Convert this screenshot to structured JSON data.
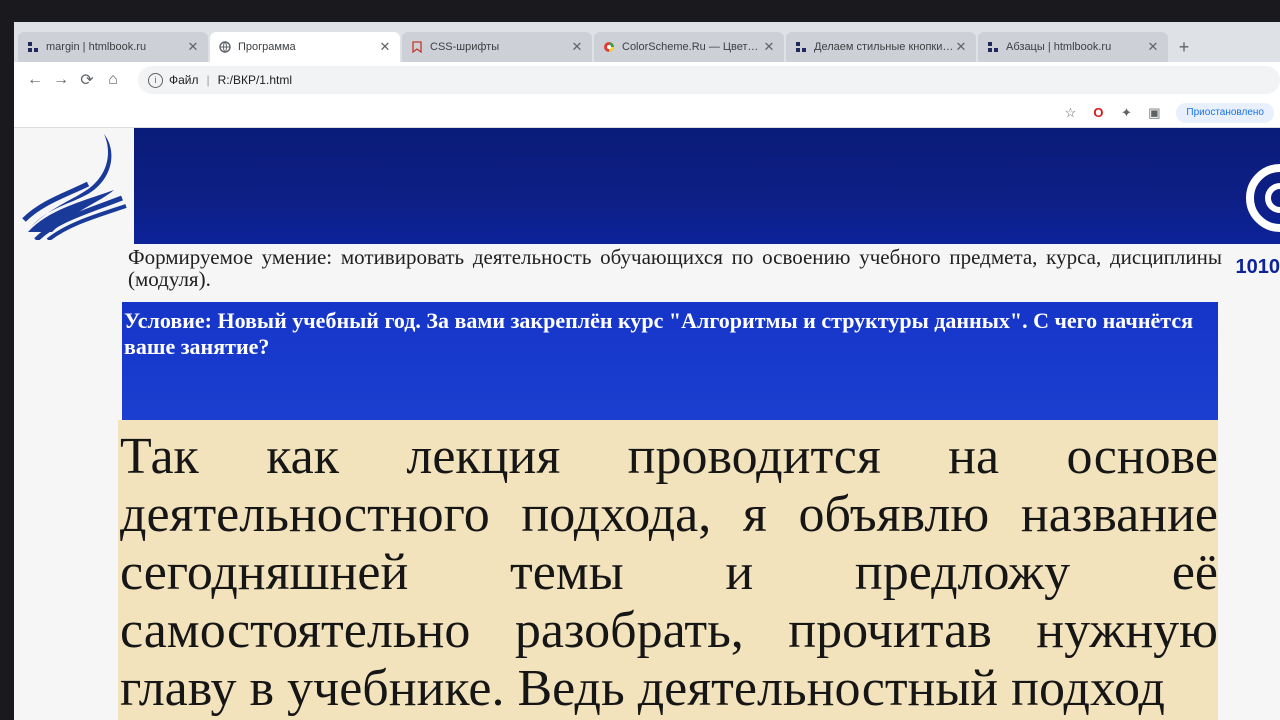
{
  "tabs": [
    {
      "title": "margin | htmlbook.ru",
      "icon": "htmlbook-icon",
      "active": false
    },
    {
      "title": "Программа",
      "icon": "globe-icon",
      "active": true
    },
    {
      "title": "CSS-шрифты",
      "icon": "bookmark-icon",
      "active": false
    },
    {
      "title": "ColorScheme.Ru — Цветовой",
      "icon": "colorwheel-icon",
      "active": false
    },
    {
      "title": "Делаем стильные кнопки | htmlbook.ru",
      "icon": "htmlbook-icon",
      "active": false
    },
    {
      "title": "Абзацы | htmlbook.ru",
      "icon": "htmlbook-icon",
      "active": false
    }
  ],
  "toolbar": {
    "address_scheme": "Файл",
    "address_path": "R:/ВКР/1.html"
  },
  "bookmarks_bar": {
    "profile_label": "Приостановлено"
  },
  "page": {
    "skill_text": "Формируемое умение: мотивировать деятельность обучающихся по освоению учебного предмета, курса, дисциплины (модуля).",
    "condition_text": "Условие: Новый учебный год. За вами закреплён курс \"Алгоритмы и структуры данных\". С чего начнётся ваше занятие?",
    "lecture_text": "Так как лекция проводится на основе деятельностного подхода, я объявлю название сегодняшней темы и предложу её самостоятельно разобрать, прочитав нужную главу в учебнике. Ведь деятельностный подход",
    "brand_number": "1010"
  },
  "colors": {
    "banner": "#0d1f85",
    "condition_bg": "#1c3fd0",
    "lecture_bg": "#f2e3bd",
    "logo": "#1a3a9a"
  }
}
